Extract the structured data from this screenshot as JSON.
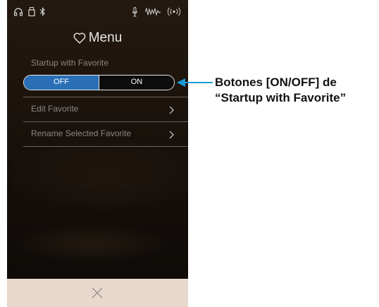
{
  "status_bar": {
    "icons": [
      "headphones-icon",
      "usb-drive-icon",
      "bluetooth-icon",
      "microphone-icon",
      "audio-wave-icon",
      "wireless-icon"
    ]
  },
  "menu": {
    "title": "Menu",
    "icon": "heart-icon",
    "section_label": "Startup with Favorite",
    "toggle": {
      "off_label": "OFF",
      "on_label": "ON",
      "selected": "OFF",
      "accent": "#2a6fb6"
    },
    "items": [
      {
        "label": "Edit Favorite"
      },
      {
        "label": "Rename Selected Favorite"
      }
    ]
  },
  "bottom_bar": {
    "icon": "close-icon",
    "color": "#e8d8cc"
  },
  "callout": {
    "line1": "Botones [ON/OFF] de",
    "line2": "“Startup with Favorite”",
    "color": "#1a9ad6"
  }
}
